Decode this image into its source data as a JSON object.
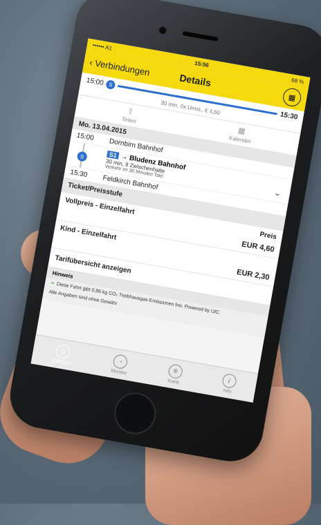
{
  "status": {
    "carrier": "•••••• A1",
    "time": "15:56",
    "battery": "68 %"
  },
  "nav": {
    "back_label": "‹ Verbindungen",
    "title": "Details",
    "calendar_icon": "calendar-icon"
  },
  "summary": {
    "dep_time": "15:00",
    "arr_time": "15:30",
    "sub": "30 min, 0x Umst., € 4,60"
  },
  "actions": [
    {
      "label": "Teilen",
      "icon": "share-icon"
    },
    {
      "label": "Kalender",
      "icon": "calendar-icon"
    }
  ],
  "trip": {
    "date": "Mo. 13.04.2015",
    "from": {
      "time": "15:00",
      "station": "Dornbirn Bahnhof"
    },
    "leg": {
      "line": "S1",
      "to": "→ Bludenz Bahnhof",
      "detail": "30 min, 9 Zwischenhalte",
      "takt": "Verkehr im 30 Minuten Takt."
    },
    "to": {
      "time": "15:30",
      "station": "Feldkirch Bahnhof"
    }
  },
  "tickets": {
    "header": "Ticket/Preisstufe",
    "rows": [
      {
        "label": "Vollpreis - Einzelfahrt",
        "col": "Preis",
        "price": "EUR 4,60"
      },
      {
        "label": "Kind - Einzelfahrt",
        "col": "",
        "price": "EUR 2,30"
      }
    ]
  },
  "tarif_link": "Tarifübersicht anzeigen",
  "hint": {
    "title": "Hinweis",
    "co2": "Diese Fahrt gibt 0,86 kg CO₂ Treibhausgas-Emissionen frei. Powered by UIC.",
    "disclaimer": "Alle Angaben sind ohne Gewähr"
  },
  "tabs": [
    {
      "label": "Fahrplan",
      "icon": "compass-icon",
      "glyph": "◎"
    },
    {
      "label": "Monitor",
      "icon": "monitor-icon",
      "glyph": "◔"
    },
    {
      "label": "Karte",
      "icon": "map-icon",
      "glyph": "⊕"
    },
    {
      "label": "Info",
      "icon": "info-icon",
      "glyph": "i"
    }
  ]
}
